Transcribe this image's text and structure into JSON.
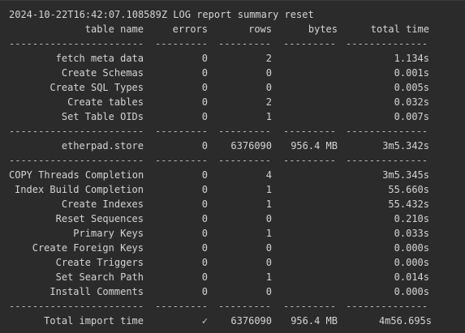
{
  "log_line": "2024-10-22T16:42:07.108589Z LOG report summary reset",
  "header": {
    "table_name": "table name",
    "errors": "errors",
    "rows": "rows",
    "bytes": "bytes",
    "total_time": "total time"
  },
  "separator": {
    "c0": "-----------------------",
    "c1": "---------",
    "c2": "---------",
    "c3": "---------",
    "c4": "--------------"
  },
  "section1": [
    {
      "name": "fetch meta data",
      "errors": "0",
      "rows": "2",
      "bytes": "",
      "time": "1.134s"
    },
    {
      "name": "Create Schemas",
      "errors": "0",
      "rows": "0",
      "bytes": "",
      "time": "0.001s"
    },
    {
      "name": "Create SQL Types",
      "errors": "0",
      "rows": "0",
      "bytes": "",
      "time": "0.005s"
    },
    {
      "name": "Create tables",
      "errors": "0",
      "rows": "2",
      "bytes": "",
      "time": "0.032s"
    },
    {
      "name": "Set Table OIDs",
      "errors": "0",
      "rows": "1",
      "bytes": "",
      "time": "0.007s"
    }
  ],
  "section2": [
    {
      "name": "etherpad.store",
      "errors": "0",
      "rows": "6376090",
      "bytes": "956.4 MB",
      "time": "3m5.342s"
    }
  ],
  "section3": [
    {
      "name": "COPY Threads Completion",
      "errors": "0",
      "rows": "4",
      "bytes": "",
      "time": "3m5.345s"
    },
    {
      "name": "Index Build Completion",
      "errors": "0",
      "rows": "1",
      "bytes": "",
      "time": "55.660s"
    },
    {
      "name": "Create Indexes",
      "errors": "0",
      "rows": "1",
      "bytes": "",
      "time": "55.432s"
    },
    {
      "name": "Reset Sequences",
      "errors": "0",
      "rows": "0",
      "bytes": "",
      "time": "0.210s"
    },
    {
      "name": "Primary Keys",
      "errors": "0",
      "rows": "1",
      "bytes": "",
      "time": "0.033s"
    },
    {
      "name": "Create Foreign Keys",
      "errors": "0",
      "rows": "0",
      "bytes": "",
      "time": "0.000s"
    },
    {
      "name": "Create Triggers",
      "errors": "0",
      "rows": "0",
      "bytes": "",
      "time": "0.000s"
    },
    {
      "name": "Set Search Path",
      "errors": "0",
      "rows": "1",
      "bytes": "",
      "time": "0.014s"
    },
    {
      "name": "Install Comments",
      "errors": "0",
      "rows": "0",
      "bytes": "",
      "time": "0.000s"
    }
  ],
  "total": {
    "name": "Total import time",
    "errors": "✓",
    "rows": "6376090",
    "bytes": "956.4 MB",
    "time": "4m56.695s"
  }
}
